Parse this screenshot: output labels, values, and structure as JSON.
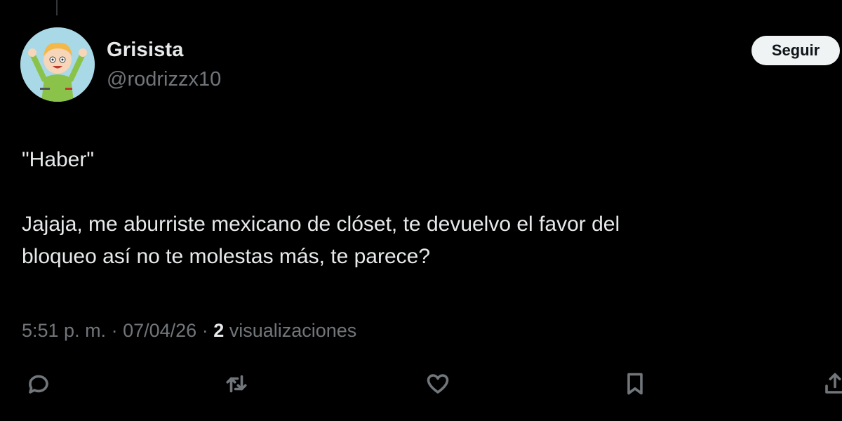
{
  "tweet": {
    "author": {
      "display_name": "Grisista",
      "handle": "@rodrizzx10"
    },
    "follow_label": "Seguir",
    "body": {
      "line1": "\"Haber\"",
      "line2": "Jajaja, me aburriste mexicano de clóset, te devuelvo el favor del",
      "line3": "bloqueo así no te molestas más, te parece?"
    },
    "meta": {
      "time": "5:51 p. m.",
      "separator1": " · ",
      "date": "07/04/26",
      "separator2": " · ",
      "views_count": "2",
      "views_label": " visualizaciones"
    },
    "actions": [
      {
        "icon": "reply-icon"
      },
      {
        "icon": "retweet-icon"
      },
      {
        "icon": "like-icon"
      },
      {
        "icon": "bookmark-icon"
      },
      {
        "icon": "share-icon"
      }
    ]
  },
  "colors": {
    "background": "#000000",
    "primary_text": "#e7e9ea",
    "secondary_text": "#71767b",
    "button_bg": "#eff3f4",
    "button_text": "#0f1419"
  }
}
